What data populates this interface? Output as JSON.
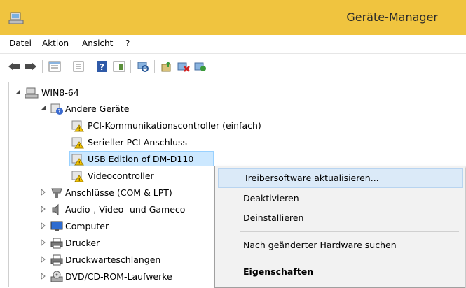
{
  "window": {
    "title": "Geräte-Manager"
  },
  "menubar": {
    "items": [
      "Datei",
      "Aktion",
      "Ansicht",
      "?"
    ]
  },
  "toolbar": {
    "buttons": [
      "back-icon",
      "forward-icon",
      "properties-view-icon",
      "device-list-icon",
      "help-icon",
      "panel-icon",
      "scan-hardware-icon",
      "update-driver-icon",
      "uninstall-icon",
      "enable-icon"
    ]
  },
  "tree": {
    "root": "WIN8-64",
    "other_devices": "Andere Geräte",
    "devices": [
      "PCI-Kommunikationscontroller (einfach)",
      "Serieller PCI-Anschluss",
      "USB Edition of DM-D110",
      "Videocontroller"
    ],
    "categories": [
      "Anschlüsse (COM & LPT)",
      "Audio-, Video- und Gameco",
      "Computer",
      "Drucker",
      "Druckwarteschlangen",
      "DVD/CD-ROM-Laufwerke"
    ]
  },
  "context_menu": {
    "items": [
      "Treibersoftware aktualisieren...",
      "Deaktivieren",
      "Deinstallieren",
      "Nach geänderter Hardware suchen",
      "Eigenschaften"
    ]
  },
  "colors": {
    "titlebar": "#f0c43f",
    "selection": "#cce8ff",
    "menu_highlight": "#dbeaf8"
  }
}
